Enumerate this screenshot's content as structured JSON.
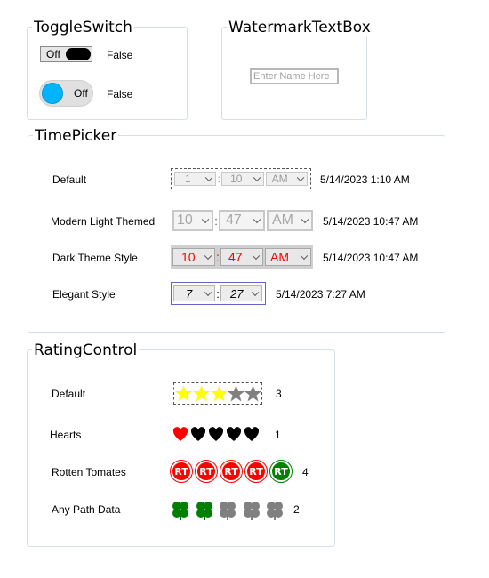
{
  "toggle_group": {
    "title": "ToggleSwitch",
    "switch1": {
      "state_label": "Off",
      "value": "False"
    },
    "switch2": {
      "state_label": "Off",
      "value": "False"
    }
  },
  "watermark_group": {
    "title": "WatermarkTextBox",
    "placeholder": "Enter Name Here"
  },
  "timepicker_group": {
    "title": "TimePicker",
    "rows": [
      {
        "label": "Default",
        "hour": "1",
        "minute": "10",
        "ampm": "AM",
        "result": "5/14/2023 1:10 AM"
      },
      {
        "label": "Modern Light Themed",
        "hour": "10",
        "minute": "47",
        "ampm": "AM",
        "result": "5/14/2023 10:47 AM"
      },
      {
        "label": "Dark Theme Style",
        "hour": "10",
        "minute": "47",
        "ampm": "AM",
        "result": "5/14/2023 10:47 AM"
      },
      {
        "label": "Elegant Style",
        "hour": "7",
        "minute": "27",
        "result": "5/14/2023 7:27 AM"
      }
    ],
    "separator": ":"
  },
  "rating_group": {
    "title": "RatingControl",
    "rows": [
      {
        "label": "Default",
        "value": "3",
        "max": 5,
        "filled_color": "#ffff00",
        "empty_color": "#808080"
      },
      {
        "label": "Hearts",
        "value": "1",
        "max": 5,
        "filled_color": "#ff0000",
        "empty_color": "#000000"
      },
      {
        "label": "Rotten Tomates",
        "value": "4",
        "max": 5,
        "filled_color": "#ff0000",
        "empty_color": "#008000",
        "icon_text": "RT"
      },
      {
        "label": "Any Path Data",
        "value": "2",
        "max": 5,
        "filled_color": "#008000",
        "empty_color": "#808080"
      }
    ]
  },
  "colors": {
    "group_border": "#d5dfe5",
    "toggle_knob_on": "#00b4ff",
    "dark_text": "#ff0000",
    "elegant_border": "#6464c8"
  }
}
